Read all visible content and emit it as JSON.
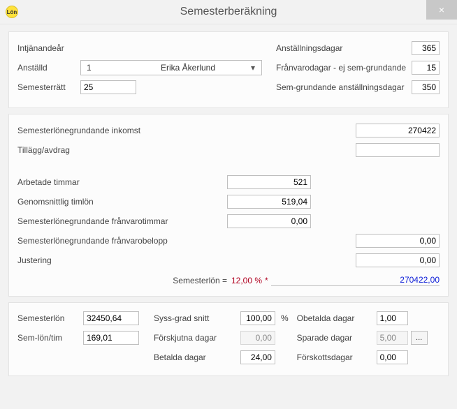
{
  "window": {
    "title": "Semesterberäkning",
    "app_icon_text": "Lön",
    "close_glyph": "×"
  },
  "top": {
    "left": {
      "intjanandear_label": "Intjänandeår",
      "anstalld_label": "Anställd",
      "anstalld_id": "1",
      "anstalld_name": "Erika Åkerlund",
      "semesterratt_label": "Semesterrätt",
      "semesterratt": "25"
    },
    "right": {
      "anstallningsdagar_label": "Anställningsdagar",
      "anstallningsdagar": "365",
      "franvaro_label": "Frånvarodagar - ej sem-grundande",
      "franvaro": "15",
      "semgr_anst_label": "Sem-grundande anställningsdagar",
      "semgr_anst": "350"
    }
  },
  "mid": {
    "sloneg_inkomst_label": "Semesterlönegrundande inkomst",
    "sloneg_inkomst": "270422",
    "tillagg_label": "Tillägg/avdrag",
    "tillagg": "",
    "arbetade_label": "Arbetade timmar",
    "arbetade": "521",
    "snittlon_label": "Genomsnittlig timlön",
    "snittlon": "519,04",
    "franvarotim_label": "Semesterlönegrundande frånvarotimmar",
    "franvarotim": "0,00",
    "franvarobel_label": "Semesterlönegrundande frånvarobelopp",
    "franvarobel": "0,00",
    "justering_label": "Justering",
    "justering": "0,00",
    "calc_label": "Semesterlön  =",
    "calc_pct": "12,00 %",
    "calc_star": " *",
    "calc_result": "270422,00"
  },
  "bottom": {
    "semesterlon_label": "Semesterlön",
    "semesterlon": "32450,64",
    "semlontim_label": "Sem-lön/tim",
    "semlontim": "169,01",
    "syss_label": "Syss-grad snitt",
    "syss": "100,00",
    "pct_sign": "%",
    "forskjutna_label": "Förskjutna dagar",
    "forskjutna": "0,00",
    "betalda_label": "Betalda dagar",
    "betalda": "24,00",
    "obetalda_label": "Obetalda dagar",
    "obetalda": "1,00",
    "sparade_label": "Sparade dagar",
    "sparade": "5,00",
    "sparade_btn": "...",
    "forskotts_label": "Förskottsdagar",
    "forskotts": "0,00"
  }
}
